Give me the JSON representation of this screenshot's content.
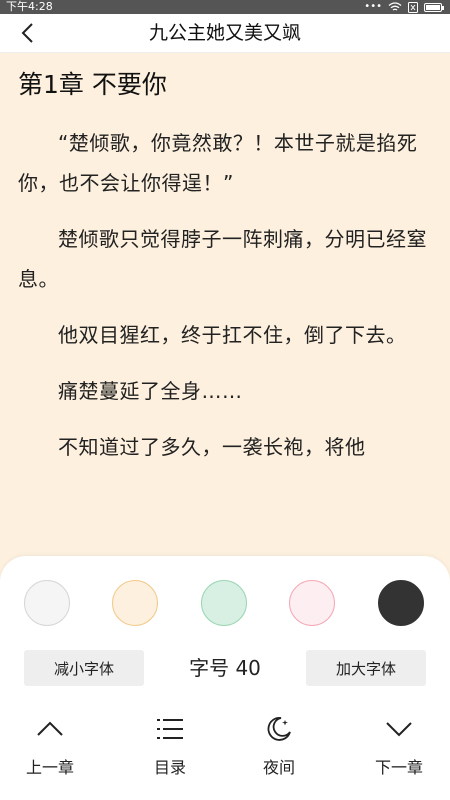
{
  "status_bar": {
    "time": "下午4:28",
    "icons": [
      "dots-icon",
      "wifi-icon",
      "sim-icon",
      "battery-icon"
    ]
  },
  "nav": {
    "title": "九公主她又美又飒",
    "back_icon": "chevron-left-icon"
  },
  "chapter": {
    "title": "第1章 不要你",
    "paragraphs": [
      "“楚倾歌，你竟然敢？！本世子就是掐死你，也不会让你得逞！”",
      "楚倾歌只觉得脖子一阵刺痛，分明已经窒息。",
      "他双目猩红，终于扛不住，倒了下去。",
      "痛楚蔓延了全身……",
      "不知道过了多久，一袭长袍，将他"
    ]
  },
  "settings": {
    "themes": [
      {
        "name": "white",
        "fill": "#f5f5f5",
        "border": "#d6d6d6"
      },
      {
        "name": "beige",
        "fill": "#fdf0de",
        "border": "#f2c98c"
      },
      {
        "name": "green",
        "fill": "#d8f0e3",
        "border": "#9bd6b3"
      },
      {
        "name": "pink",
        "fill": "#fdeef1",
        "border": "#f3a9b8"
      },
      {
        "name": "night",
        "fill": "#333333",
        "border": "#333333"
      }
    ],
    "decrease_label": "减小字体",
    "font_size_label": "字号 40",
    "increase_label": "加大字体"
  },
  "bottom_nav": [
    {
      "label": "上一章",
      "icon": "chevron-up-icon"
    },
    {
      "label": "目录",
      "icon": "list-icon"
    },
    {
      "label": "夜间",
      "icon": "moon-icon"
    },
    {
      "label": "下一章",
      "icon": "chevron-down-icon"
    }
  ]
}
